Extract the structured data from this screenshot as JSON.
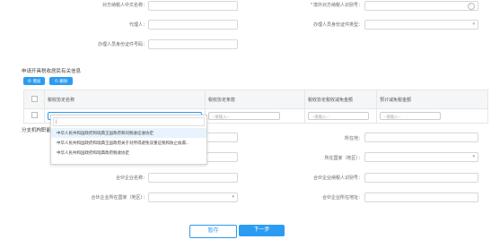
{
  "top_form": {
    "foreign_party_name_cn": "对方纳税人中文名称：",
    "foreign_party_id_label": "境外对方纳税人识别号：",
    "foreign_party_id_placeholder": "？",
    "agent_label": "代理人：",
    "agent_id_type_label": "办理人员身份证件类型：",
    "agent_id_no_label": "办理人员身份证件号码："
  },
  "section_title": "申请开具税收居民有关信息",
  "toolbar": {
    "add_label": "⊕ 增加",
    "delete_label": "⊖ 删除"
  },
  "table": {
    "headers": [
      "税收协定名称",
      "税收协定条款",
      "税收协定税收减免金额",
      "预计减免税金额"
    ],
    "row_select_placeholder": "--请输入--",
    "row_inputs": [
      "--请输入--",
      "--请输入--",
      "--请输入--"
    ]
  },
  "dropdown": {
    "search_value": "|",
    "options": [
      "中华人民共和国政府和瑞典王国政府和同税收征收协定",
      "中华人民共和国政府和瑞典王国政府关于对所得避免双重征税和防止偷漏...",
      "中华人民共和国政府和瑞典政府税收协定"
    ]
  },
  "lower_form": {
    "section_label": "分支机构职能",
    "residence_label": "所在地：",
    "country_label": "所在国家（地区）：",
    "partner_name_label": "合伙企业名称：",
    "partner_id_label": "合伙企业纳税人识别号：",
    "partner_country_label": "合伙企业所在国家（地区）：",
    "partner_address_label": "合伙企业所在地址："
  },
  "footer": {
    "save_label": "暂存",
    "next_label": "下一步"
  },
  "colors": {
    "accent": "#2b9cf2",
    "next_button": "#2b9cf2",
    "save_border": "#2b9cf2"
  }
}
